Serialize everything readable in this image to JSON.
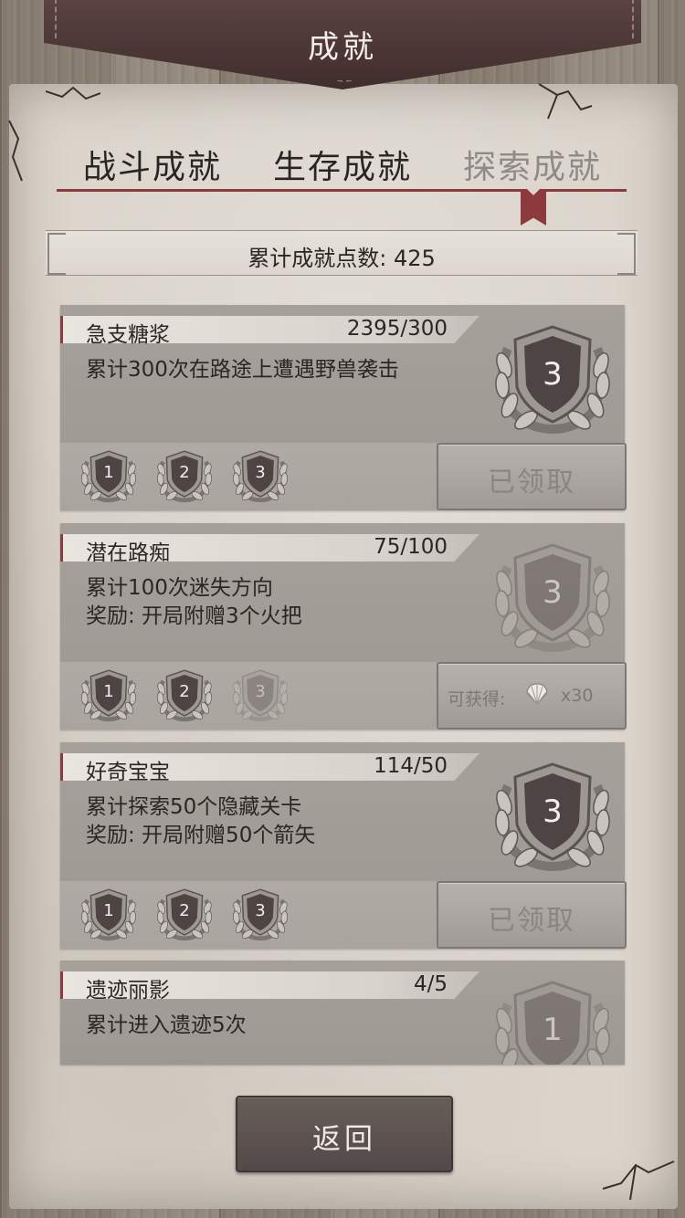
{
  "title": "成就",
  "tabs": [
    {
      "label": "战斗成就",
      "active": false
    },
    {
      "label": "生存成就",
      "active": false
    },
    {
      "label": "探索成就",
      "active": true
    }
  ],
  "total_points": "累计成就点数: 425",
  "achievements": [
    {
      "name": "急支糖浆",
      "progress": "2395/300",
      "desc_line1": "累计300次在路途上遭遇野兽袭击",
      "desc_line2": "",
      "big_medal": "3",
      "levels": [
        "1",
        "2",
        "3"
      ],
      "levels_unlocked": 3,
      "claim_label": "已领取"
    },
    {
      "name": "潜在路痴",
      "progress": "75/100",
      "desc_line1": "累计100次迷失方向",
      "desc_line2": "奖励: 开局附赠3个火把",
      "big_medal": "3",
      "levels": [
        "1",
        "2",
        "3"
      ],
      "levels_unlocked": 2,
      "claim_prefix": "可获得:",
      "claim_icon": "shell-icon",
      "claim_count": "x30"
    },
    {
      "name": "好奇宝宝",
      "progress": "114/50",
      "desc_line1": "累计探索50个隐藏关卡",
      "desc_line2": "奖励: 开局附赠50个箭矢",
      "big_medal": "3",
      "levels": [
        "1",
        "2",
        "3"
      ],
      "levels_unlocked": 3,
      "claim_label": "已领取"
    },
    {
      "name": "遗迹丽影",
      "progress": "4/5",
      "desc_line1": "累计进入遗迹5次",
      "desc_line2": "",
      "big_medal": "1"
    }
  ],
  "back_label": "返回",
  "colors": {
    "accent_red": "#8c3a3e",
    "medal_dark": "#4e4444",
    "paper": "#dbd5cc"
  }
}
